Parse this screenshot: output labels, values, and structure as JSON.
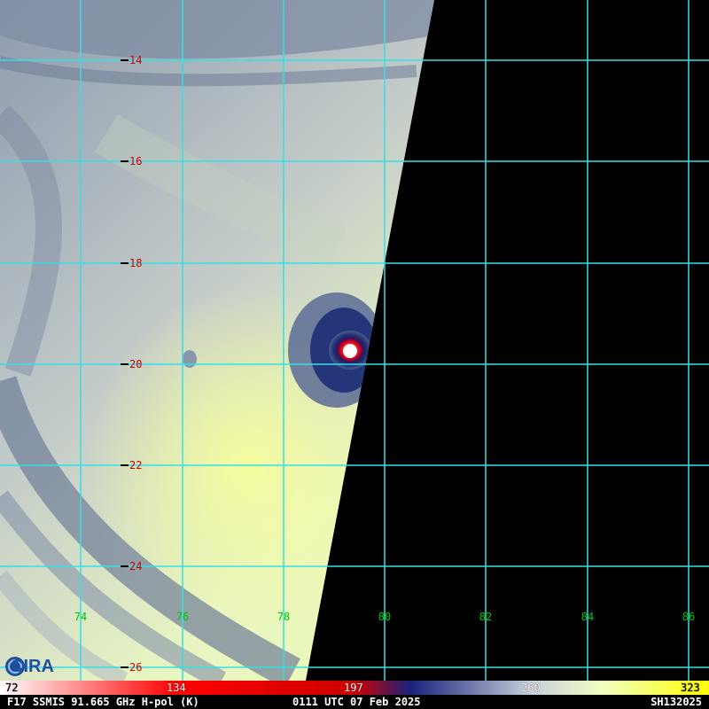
{
  "map": {
    "lat_labels": [
      "14",
      "16",
      "18",
      "20",
      "22",
      "24",
      "26"
    ],
    "lon_labels": [
      "74",
      "76",
      "78",
      "80",
      "82",
      "84",
      "86"
    ],
    "colors": {
      "grid": "#33e0e6",
      "lat_label": "#d00000",
      "lon_label": "#00c800",
      "no_data": "#000000"
    },
    "storm_center_marker": "warm eye ring"
  },
  "colorbar": {
    "ticks": [
      "72",
      "134",
      "197",
      "260",
      "323"
    ],
    "colors": [
      "#ffffff",
      "#ff0000",
      "#1a237e",
      "#ffffff",
      "#ffff00"
    ]
  },
  "footer": {
    "sensor": "F17 SSMIS 91.665 GHz H-pol (K)",
    "time": "0111 UTC 07 Feb 2025",
    "storm_id": "SH132025"
  },
  "logo": {
    "text": "CIRA",
    "icon": "cira-logo-icon"
  }
}
